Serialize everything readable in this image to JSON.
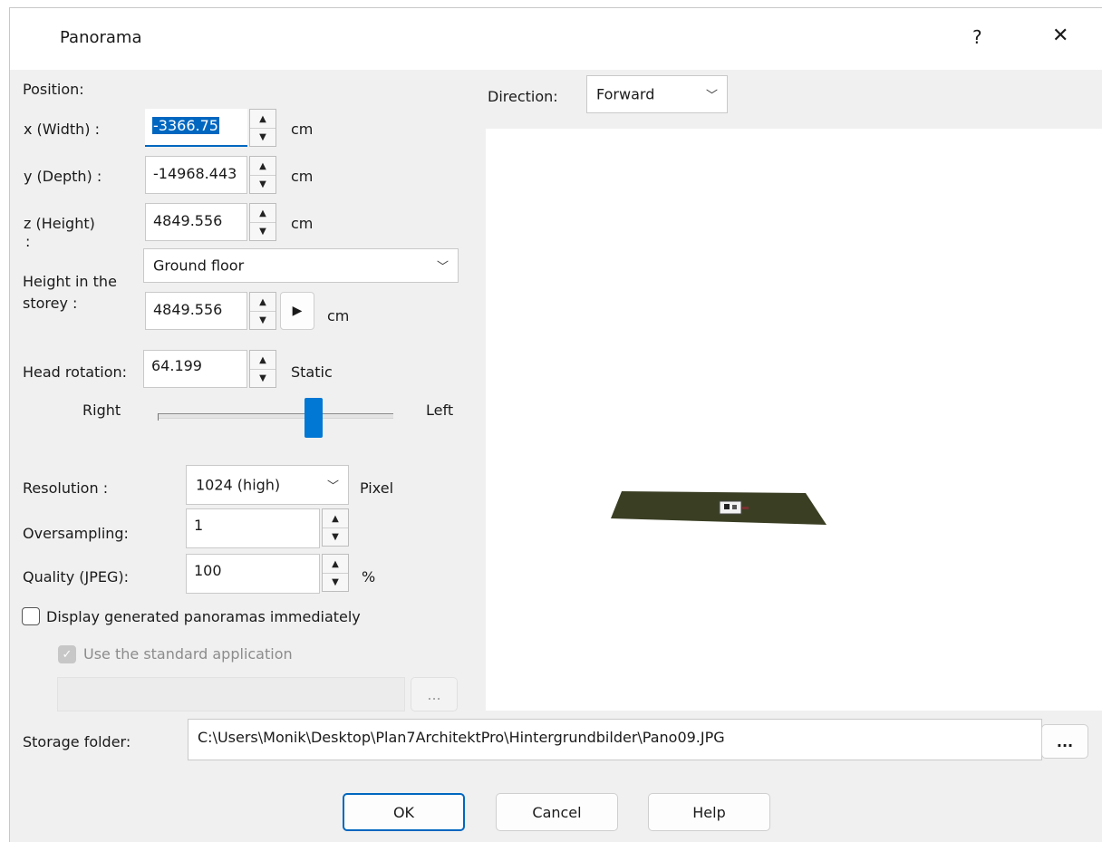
{
  "dialog": {
    "title": "Panorama",
    "help_glyph": "?",
    "close_glyph": "✕"
  },
  "position": {
    "heading": "Position:",
    "x_label": "x (Width) :",
    "x_value": "-3366.75",
    "x_unit": "cm",
    "y_label": "y (Depth) :",
    "y_value": "-14968.443",
    "y_unit": "cm",
    "z_label": "z (Height)",
    "z_label_colon": ":",
    "z_value": "4849.556",
    "z_unit": "cm"
  },
  "storey": {
    "label_line1": "Height in the",
    "label_line2": "storey :",
    "floor_selected": "Ground floor",
    "height_value": "4849.556",
    "height_unit": "cm"
  },
  "head_rotation": {
    "label": "Head rotation:",
    "value": "64.199",
    "mode": "Static",
    "slider_left_label": "Right",
    "slider_right_label": "Left",
    "slider_fraction": 0.66
  },
  "resolution": {
    "label": "Resolution :",
    "selected": "1024 (high)",
    "unit": "Pixel"
  },
  "oversampling": {
    "label": "Oversampling:",
    "value": "1"
  },
  "quality": {
    "label": "Quality (JPEG):",
    "value": "100",
    "unit": "%"
  },
  "display_immediately": {
    "label": "Display generated panoramas immediately",
    "checked": false
  },
  "standard_app": {
    "label": "Use the standard application",
    "checked": true,
    "disabled": true,
    "path_value": "",
    "browse_label": "..."
  },
  "direction": {
    "label": "Direction:",
    "selected": "Forward"
  },
  "storage": {
    "label": "Storage folder:",
    "value": "C:\\Users\\Monik\\Desktop\\Plan7ArchitektPro\\Hintergrundbilder\\Pano09.JPG",
    "browse_label": "..."
  },
  "buttons": {
    "ok": "OK",
    "cancel": "Cancel",
    "help": "Help"
  },
  "icons": {
    "spin_up": "▲",
    "spin_down": "▼",
    "chevron": "﹀",
    "play": "▶",
    "check": "✓"
  },
  "colors": {
    "accent": "#0067c0",
    "ground_plane": "#3a3f24"
  }
}
